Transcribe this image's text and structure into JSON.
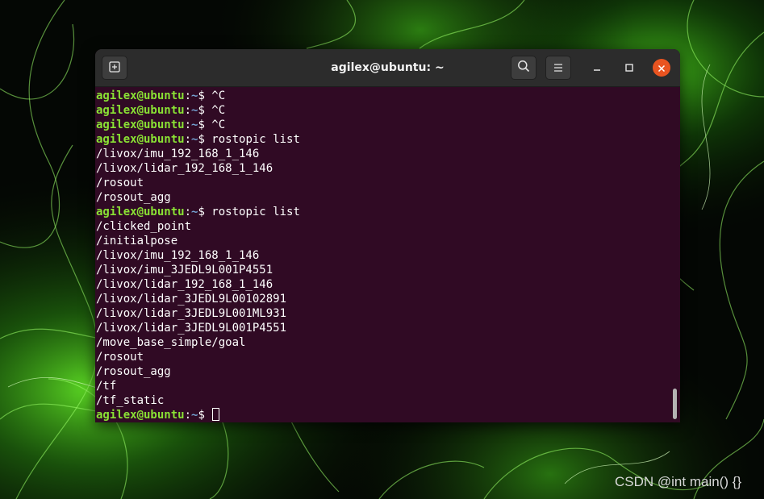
{
  "window": {
    "title": "agilex@ubuntu: ~",
    "new_tab_icon": "new-tab-icon",
    "search_icon": "search-icon",
    "menu_icon": "hamburger-menu-icon",
    "minimize_icon": "minimize-icon",
    "maximize_icon": "maximize-icon",
    "close_icon": "close-icon"
  },
  "colors": {
    "terminal_bg": "#300a24",
    "prompt_user": "#8ae234",
    "prompt_path": "#729fcf",
    "close_button": "#e95420"
  },
  "terminal": {
    "lines": [
      {
        "user": "agilex@ubuntu",
        "sep": ":",
        "path": "~",
        "cmd": "$ ^C"
      },
      {
        "user": "agilex@ubuntu",
        "sep": ":",
        "path": "~",
        "cmd": "$ ^C"
      },
      {
        "user": "agilex@ubuntu",
        "sep": ":",
        "path": "~",
        "cmd": "$ ^C"
      },
      {
        "user": "agilex@ubuntu",
        "sep": ":",
        "path": "~",
        "cmd": "$ rostopic list"
      },
      {
        "text": "/livox/imu_192_168_1_146"
      },
      {
        "text": "/livox/lidar_192_168_1_146"
      },
      {
        "text": "/rosout"
      },
      {
        "text": "/rosout_agg"
      },
      {
        "user": "agilex@ubuntu",
        "sep": ":",
        "path": "~",
        "cmd": "$ rostopic list"
      },
      {
        "text": "/clicked_point"
      },
      {
        "text": "/initialpose"
      },
      {
        "text": "/livox/imu_192_168_1_146"
      },
      {
        "text": "/livox/imu_3JEDL9L001P4551"
      },
      {
        "text": "/livox/lidar_192_168_1_146"
      },
      {
        "text": "/livox/lidar_3JEDL9L00102891"
      },
      {
        "text": "/livox/lidar_3JEDL9L001ML931"
      },
      {
        "text": "/livox/lidar_3JEDL9L001P4551"
      },
      {
        "text": "/move_base_simple/goal"
      },
      {
        "text": "/rosout"
      },
      {
        "text": "/rosout_agg"
      },
      {
        "text": "/tf"
      },
      {
        "text": "/tf_static"
      },
      {
        "user": "agilex@ubuntu",
        "sep": ":",
        "path": "~",
        "cmd": "$ ",
        "cursor": true
      }
    ]
  },
  "watermark": "CSDN @int main() {}"
}
